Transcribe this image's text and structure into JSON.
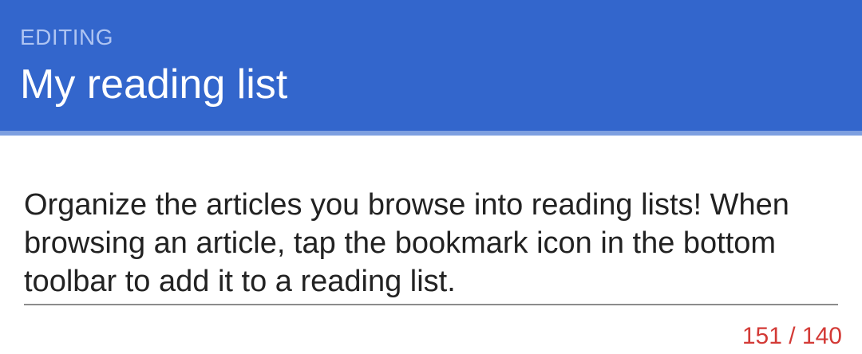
{
  "header": {
    "mode_label": "EDITING",
    "title": "My reading list"
  },
  "description_field": {
    "value": "Organize the articles you browse into reading lists! When browsing an article, tap the bookmark icon in the bottom toolbar to add it to a reading list.",
    "char_count": "151 / 140"
  },
  "colors": {
    "header_background": "#3366cc",
    "error_counter": "#d33a36"
  }
}
